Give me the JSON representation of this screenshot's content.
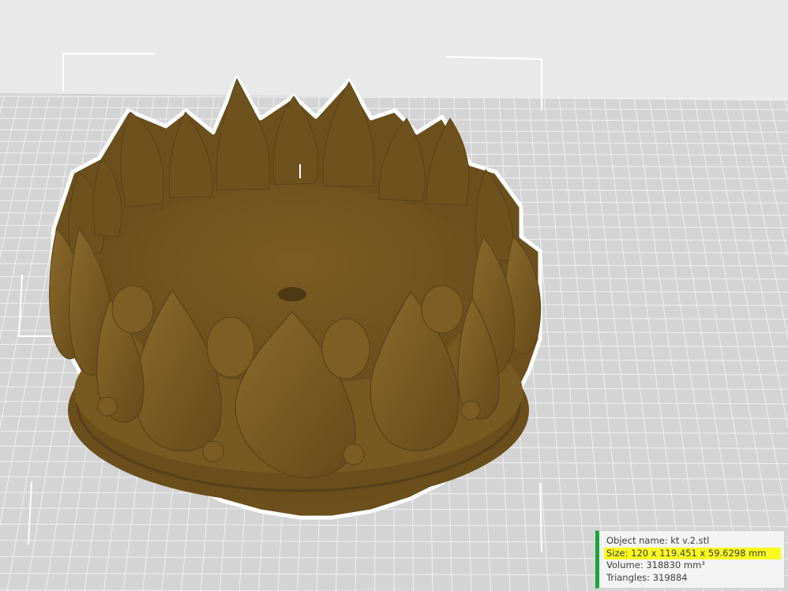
{
  "viewport": {
    "background_color": "#e6e6e6",
    "bed_color": "#d3d3d3",
    "grid_color": "#ffffff",
    "model_color": "#7a5b22",
    "model_outline_color": "#ffffff"
  },
  "object_info": {
    "name_label": "Object name:",
    "name_value": "kt v.2.stl",
    "size_label": "Size:",
    "size_value": "120 x 119.451 x 59.6298 mm",
    "volume_label": "Volume:",
    "volume_value": "318830 mm³",
    "triangles_label": "Triangles:",
    "triangles_value": "319884",
    "accent_color": "#1aa33a",
    "highlight_color": "#fafa1e"
  }
}
